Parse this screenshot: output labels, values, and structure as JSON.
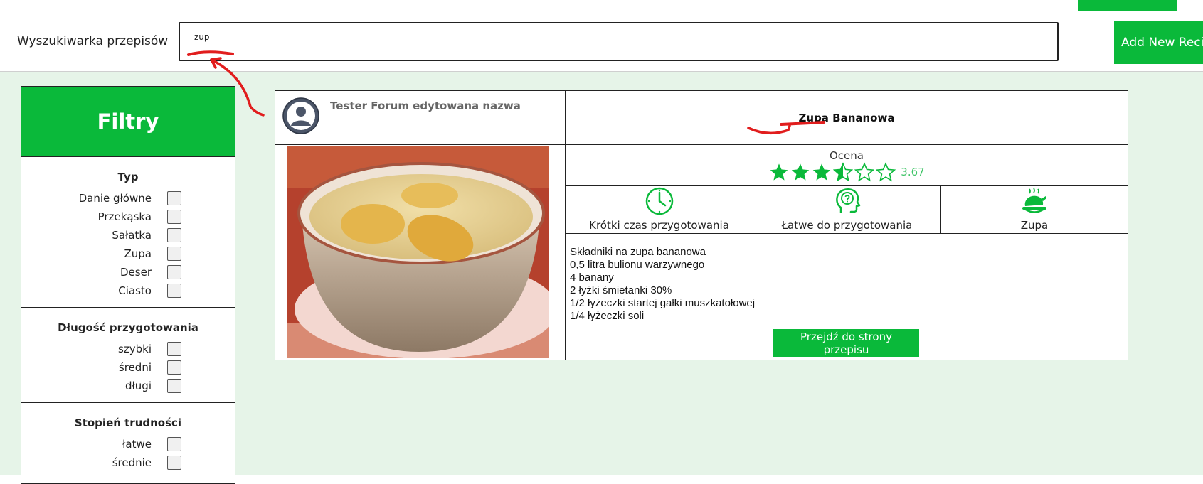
{
  "header": {
    "search_label": "Wyszukiwarka przepisów",
    "search_value": "zup",
    "add_button_label": "Add New Recipe"
  },
  "sidebar": {
    "title": "Filtry",
    "groups": [
      {
        "title": "Typ",
        "options": [
          "Danie główne",
          "Przekąska",
          "Sałatka",
          "Zupa",
          "Deser",
          "Ciasto"
        ]
      },
      {
        "title": "Długość przygotowania",
        "options": [
          "szybki",
          "średni",
          "długi"
        ]
      },
      {
        "title": "Stopień trudności",
        "options": [
          "łatwe",
          "średnie"
        ]
      }
    ]
  },
  "recipe": {
    "author": "Tester Forum edytowana nazwa",
    "title": "Zupa Bananowa",
    "rating_label": "Ocena",
    "rating_value": "3.67",
    "rating_numeric": 3.67,
    "rating_max": 5,
    "features": [
      {
        "icon": "clock-icon",
        "label": "Krótki czas przygotowania"
      },
      {
        "icon": "head-question-icon",
        "label": "Łatwe do przygotowania"
      },
      {
        "icon": "roast-chicken-icon",
        "label": "Zupa"
      }
    ],
    "ingredients": [
      "Składniki na zupa bananowa",
      "0,5 litra bulionu warzywnego",
      "4 banany",
      "2 łyżki śmietanki 30%",
      "1/2 łyżeczki startej gałki muszkatołowej",
      "1/4 łyżeczki soli"
    ],
    "go_button_label": "Przejdź do strony przepisu"
  },
  "colors": {
    "accent": "#0ab93a",
    "page_background": "#e6f4e8",
    "rating_text": "#3fc467"
  }
}
